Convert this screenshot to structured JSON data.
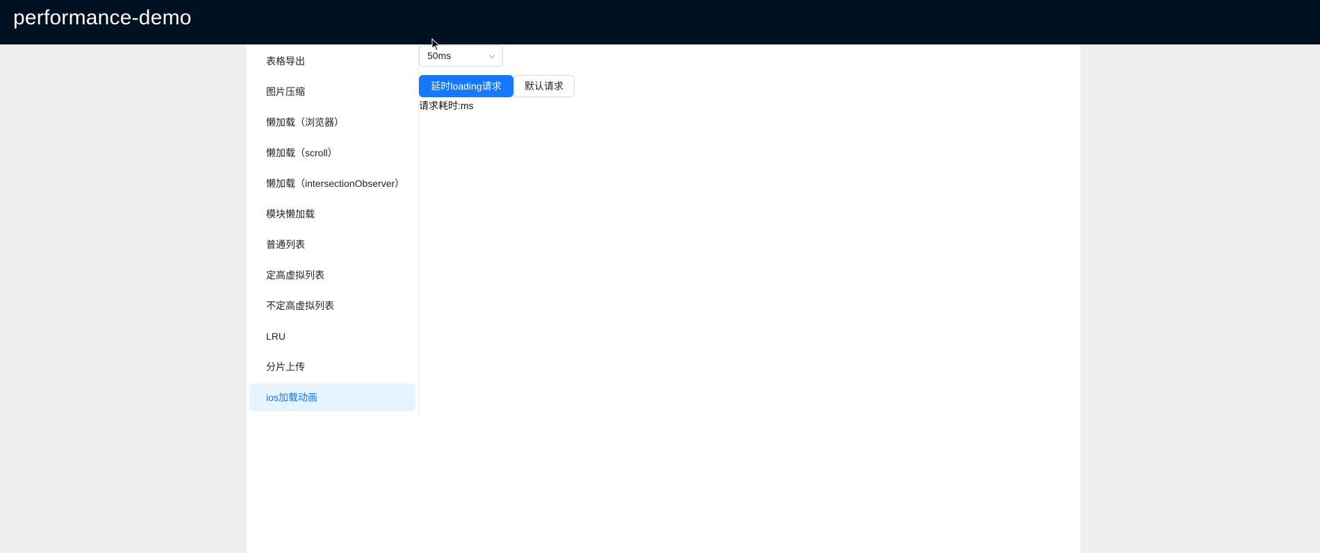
{
  "header": {
    "title": "performance-demo"
  },
  "sidebar": {
    "items": [
      {
        "label": "表格导出"
      },
      {
        "label": "图片压缩"
      },
      {
        "label": "懒加载（浏览器）"
      },
      {
        "label": "懒加载（scroll）"
      },
      {
        "label": "懒加载（intersectionObserver）"
      },
      {
        "label": "模块懒加载"
      },
      {
        "label": "普通列表"
      },
      {
        "label": "定高虚拟列表"
      },
      {
        "label": "不定高虚拟列表"
      },
      {
        "label": "LRU"
      },
      {
        "label": "分片上传"
      },
      {
        "label": "ios加载动画"
      }
    ],
    "active_index": 11
  },
  "main": {
    "delay_select": {
      "value": "50ms",
      "icon": "chevron-down-icon"
    },
    "delay_loading_button": "延时loading请求",
    "default_request_button": "默认请求",
    "result_text": "请求耗时:ms"
  },
  "colors": {
    "header_bg": "#001122",
    "primary": "#1677ff",
    "active_bg": "#e6f4ff",
    "page_bg": "#efefef"
  }
}
